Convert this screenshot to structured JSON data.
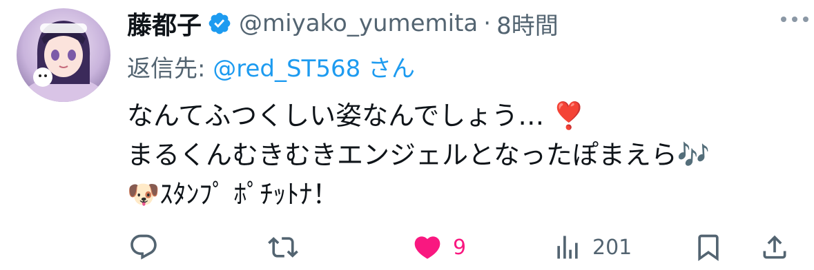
{
  "user": {
    "display_name": "藤都子",
    "handle": "@miyako_yumemita",
    "separator": "·",
    "time": "8時間"
  },
  "reply": {
    "prefix": "返信先: ",
    "mention": "@red_ST568",
    "suffix": " さん"
  },
  "content": {
    "line1": "なんてふつくしい姿なんでしょう… ❣️",
    "line2": "まるくんむきむきエンジェルとなったぽまえら🎶",
    "line3": "🐶ｽﾀﾝﾌﾟ ﾎﾟﾁｯﾄﾅ！"
  },
  "actions": {
    "reply_icon": "reply-icon",
    "retweet_icon": "retweet-icon",
    "like_icon": "heart-filled-icon",
    "like_count": "9",
    "views_icon": "views-icon",
    "views_count": "201",
    "bookmark_icon": "bookmark-icon",
    "share_icon": "share-icon"
  },
  "colors": {
    "accent": "#1d9bf0",
    "like": "#f91880",
    "secondary_text": "#536471",
    "primary_text": "#0f1419"
  }
}
